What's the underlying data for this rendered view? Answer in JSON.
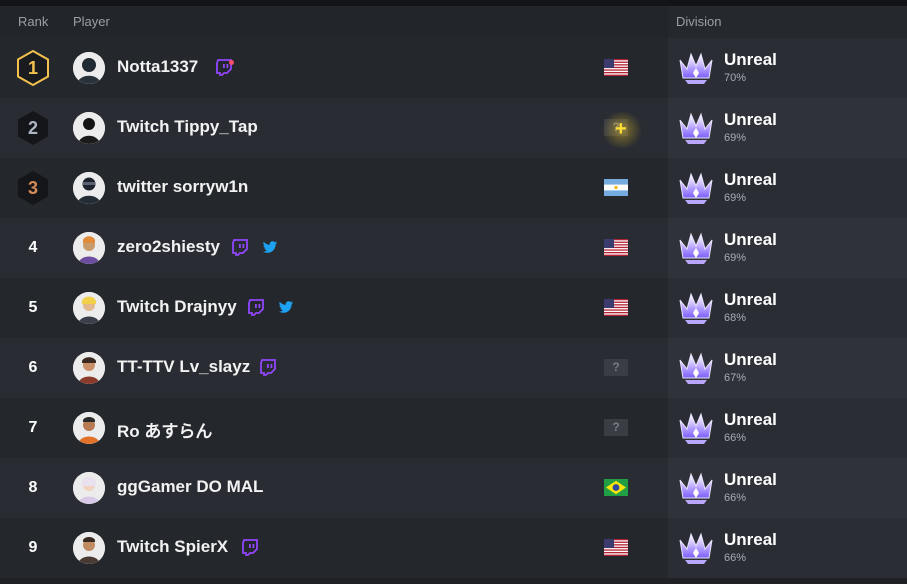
{
  "header": {
    "rank": "Rank",
    "player": "Player",
    "division": "Division"
  },
  "rows": [
    {
      "rank": "1",
      "player": "Notta1337",
      "division": "Unreal",
      "percent": "70%"
    },
    {
      "rank": "2",
      "player": "Twitch Tippy_Tap",
      "division": "Unreal",
      "percent": "69%"
    },
    {
      "rank": "3",
      "player": "twitter sorryw1n",
      "division": "Unreal",
      "percent": "69%"
    },
    {
      "rank": "4",
      "player": "zero2shiesty",
      "division": "Unreal",
      "percent": "69%"
    },
    {
      "rank": "5",
      "player": "Twitch Drajnyy",
      "division": "Unreal",
      "percent": "68%"
    },
    {
      "rank": "6",
      "player": "TT-TTV Lv_slayz",
      "division": "Unreal",
      "percent": "67%"
    },
    {
      "rank": "7",
      "player": "Ro あすらん",
      "division": "Unreal",
      "percent": "66%"
    },
    {
      "rank": "8",
      "player": "ggGamer DO MAL",
      "division": "Unreal",
      "percent": "66%"
    },
    {
      "rank": "9",
      "player": "Twitch SpierX",
      "division": "Unreal",
      "percent": "66%"
    }
  ],
  "unknown_flag": "?",
  "colors": {
    "twitch": "#9146ff",
    "twitter": "#1da1f2",
    "gold": "#f2c14e",
    "silver": "#aeb6c6",
    "bronze": "#d68a55"
  }
}
